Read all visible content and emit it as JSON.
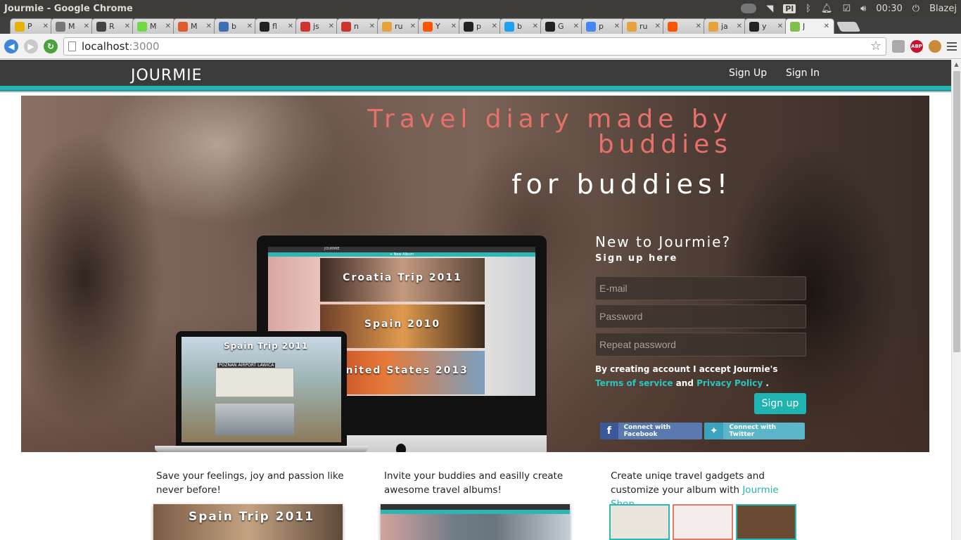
{
  "os": {
    "window_title": "Jourmie - Google Chrome",
    "lang": "Pl",
    "time": "00:30",
    "user": "Blazej"
  },
  "tabs": [
    {
      "label": "P",
      "icon": "pi-icon",
      "color": "#e8b200"
    },
    {
      "label": "M",
      "icon": "github-octocat-icon",
      "color": "#777777"
    },
    {
      "label": "R",
      "icon": "swords-icon",
      "color": "#444444"
    },
    {
      "label": "M",
      "icon": "upwork-icon",
      "color": "#6fda44"
    },
    {
      "label": "M",
      "icon": "w-icon",
      "color": "#e05a2b"
    },
    {
      "label": "b",
      "icon": "shield-icon",
      "color": "#3d6fb4"
    },
    {
      "label": "fl",
      "icon": "github-icon",
      "color": "#222222"
    },
    {
      "label": "js",
      "icon": "ruby-icon",
      "color": "#cc342d"
    },
    {
      "label": "n",
      "icon": "ruby-icon",
      "color": "#cc342d"
    },
    {
      "label": "ru",
      "icon": "bookmark-icon",
      "color": "#e8a23a"
    },
    {
      "label": "Y",
      "icon": "soundcloud-icon",
      "color": "#ff5500"
    },
    {
      "label": "p",
      "icon": "github-icon",
      "color": "#222222"
    },
    {
      "label": "b",
      "icon": "twitter-icon",
      "color": "#1da1f2"
    },
    {
      "label": "G",
      "icon": "github-icon",
      "color": "#222222"
    },
    {
      "label": "p",
      "icon": "google-icon",
      "color": "#4285f4"
    },
    {
      "label": "ru",
      "icon": "bookmark-icon",
      "color": "#e8a23a"
    },
    {
      "label": "",
      "icon": "soundcloud-icon",
      "color": "#ff5500"
    },
    {
      "label": "ja",
      "icon": "bookmark-icon",
      "color": "#e8a23a"
    },
    {
      "label": "y",
      "icon": "github-icon",
      "color": "#222222"
    },
    {
      "label": "J",
      "icon": "jourmie-icon",
      "color": "#7fbf4a",
      "active": true
    }
  ],
  "toolbar": {
    "url_host": "localhost",
    "url_port": ":3000"
  },
  "site": {
    "logo": "JOURMIE",
    "nav": {
      "signup": "Sign Up",
      "signin": "Sign In"
    },
    "accent": "#22b5b2"
  },
  "hero": {
    "tagline_line1": "Travel diary made by buddies",
    "tagline_line2": "for buddies!",
    "mock": {
      "imac_header": "JOURMIE",
      "imac_button": "+ New Album",
      "albums": [
        "Croatia Trip 2011",
        "Spain 2010",
        "United States 2013"
      ],
      "laptop_title": "Spain Trip 2011",
      "laptop_map_label": "POZNAN AIRPORT LAWICA"
    }
  },
  "signup": {
    "title": "New to Jourmie?",
    "subtitle": "Sign up here",
    "email_placeholder": "E-mail",
    "password_placeholder": "Password",
    "repeat_placeholder": "Repeat password",
    "terms_prefix": "By creating account I accept Jourmie's",
    "terms_link": "Terms of service",
    "terms_and": "and",
    "privacy_link": "Privacy Policy",
    "terms_suffix": ".",
    "button": "Sign up",
    "facebook": "Connect with Facebook",
    "twitter": "Connect with Twitter"
  },
  "features": [
    {
      "text": "Save your feelings, joy and passion like never before!"
    },
    {
      "text": "Invite your buddies and easilly create awesome travel albums!"
    },
    {
      "text_prefix": "Create uniqe travel gadgets and customize your album with",
      "link": "Jourmie Shop"
    }
  ],
  "feature_images": {
    "first_title": "Spain Trip 2011"
  }
}
